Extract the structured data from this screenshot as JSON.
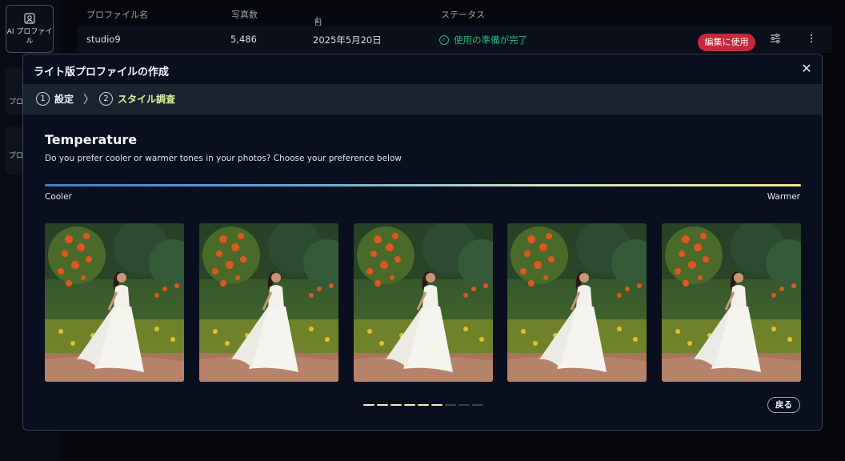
{
  "sidebar": {
    "items": [
      {
        "label": "AI プロファイル",
        "icon": "ai-profile-icon",
        "active": true
      },
      {
        "label": "プロ"
      },
      {
        "label": "プロファイ ミ"
      }
    ]
  },
  "table": {
    "headers": {
      "name": "プロファイル名",
      "photos": "写真数",
      "date": "日付",
      "status": "ステータス"
    },
    "rows": [
      {
        "name": "studio9",
        "photos": "5,486",
        "date": "2025年5月20日",
        "status": "使用の準備が完了",
        "action": "編集に使用"
      }
    ]
  },
  "modal": {
    "title": "ライト版プロファイルの作成",
    "steps": [
      {
        "num": "1",
        "label": "設定"
      },
      {
        "num": "2",
        "label": "スタイル調査"
      }
    ],
    "section": {
      "title": "Temperature",
      "subtitle": "Do you prefer cooler or warmer tones in your photos? Choose your preference below",
      "scale_left": "Cooler",
      "scale_right": "Warmer"
    },
    "thumbnails": 5,
    "pager": {
      "total": 9,
      "active": 6
    },
    "back_label": "戻る"
  },
  "colors": {
    "accent_green": "#d8f59a",
    "status_green": "#2fb37a",
    "action_red": "#c4283a",
    "gradient_cool": "#3d7fd4",
    "gradient_warm": "#f3e48a"
  }
}
